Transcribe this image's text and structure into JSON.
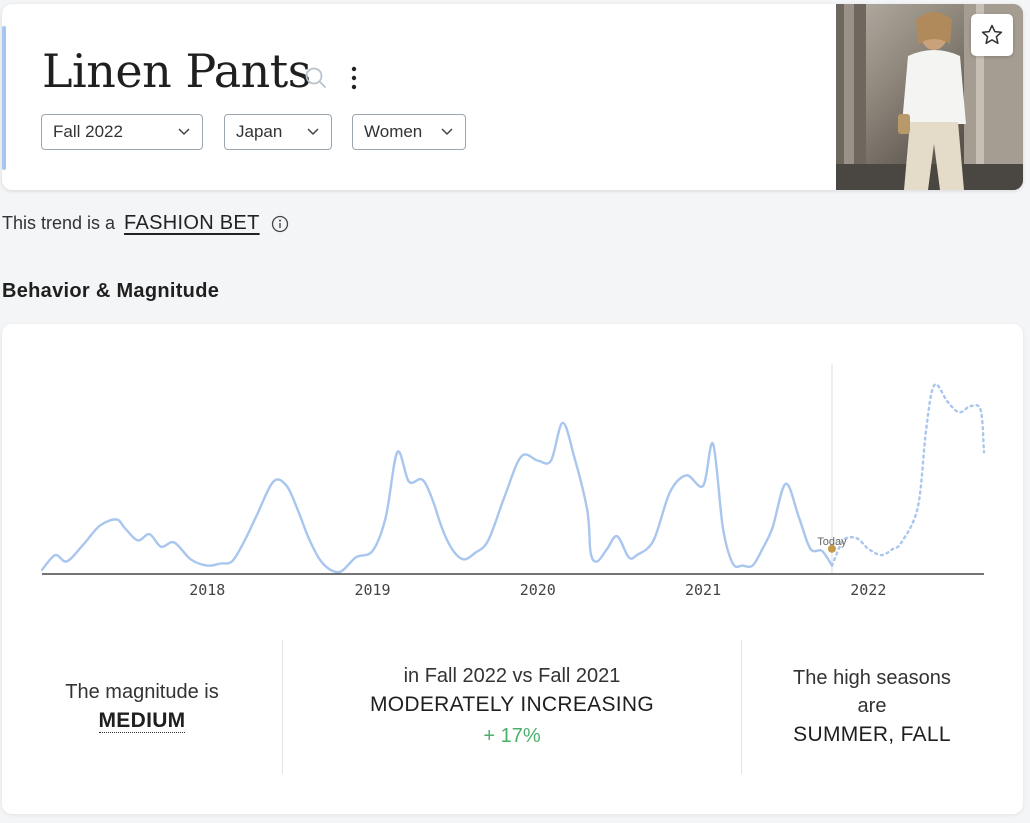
{
  "header": {
    "title": "Linen Pants",
    "filters": {
      "season": "Fall 2022",
      "country": "Japan",
      "gender": "Women"
    }
  },
  "trend": {
    "prefix": "This trend is a",
    "category": "FASHION BET"
  },
  "section": {
    "title": "Behavior & Magnitude"
  },
  "chart_data": {
    "type": "line",
    "title": "",
    "xlabel": "",
    "ylabel": "",
    "x_ticks": [
      "2018",
      "2019",
      "2020",
      "2021",
      "2022"
    ],
    "x_range": [
      2017.0,
      2022.7
    ],
    "ylim": [
      0,
      100
    ],
    "grid": false,
    "today_label": "Today",
    "today_x": 2021.78,
    "series": [
      {
        "style": "solid",
        "x": [
          2017.0,
          2017.08,
          2017.15,
          2017.25,
          2017.35,
          2017.45,
          2017.5,
          2017.58,
          2017.65,
          2017.72,
          2017.8,
          2017.9,
          2018.0,
          2018.08,
          2018.15,
          2018.22,
          2018.3,
          2018.4,
          2018.48,
          2018.55,
          2018.62,
          2018.7,
          2018.8,
          2018.9,
          2019.0,
          2019.08,
          2019.15,
          2019.22,
          2019.3,
          2019.36,
          2019.42,
          2019.48,
          2019.55,
          2019.62,
          2019.7,
          2019.8,
          2019.9,
          2020.0,
          2020.08,
          2020.15,
          2020.22,
          2020.3,
          2020.32,
          2020.36,
          2020.42,
          2020.48,
          2020.55,
          2020.6,
          2020.7,
          2020.8,
          2020.9,
          2021.0,
          2021.06,
          2021.12,
          2021.18,
          2021.24,
          2021.3,
          2021.36,
          2021.42,
          2021.5,
          2021.58,
          2021.65,
          2021.72,
          2021.78
        ],
        "y": [
          2,
          9,
          6,
          14,
          23,
          26,
          22,
          16,
          19,
          13,
          15,
          7,
          4,
          5,
          6,
          15,
          28,
          44,
          42,
          30,
          16,
          5,
          1,
          8,
          11,
          27,
          58,
          44,
          45,
          36,
          22,
          12,
          7,
          10,
          16,
          37,
          56,
          54,
          54,
          72,
          56,
          30,
          10,
          6,
          12,
          18,
          8,
          9,
          16,
          39,
          47,
          42,
          62,
          22,
          5,
          4,
          4,
          12,
          22,
          43,
          27,
          12,
          11,
          4
        ]
      },
      {
        "style": "dashed",
        "x": [
          2021.78,
          2021.85,
          2021.93,
          2022.0,
          2022.08,
          2022.15,
          2022.2,
          2022.3,
          2022.35,
          2022.4,
          2022.48,
          2022.55,
          2022.62,
          2022.68,
          2022.7
        ],
        "y": [
          4,
          16,
          17,
          12,
          9,
          12,
          15,
          32,
          69,
          90,
          82,
          77,
          80,
          78,
          58
        ]
      }
    ]
  },
  "stats": {
    "magnitude_prefix": "The magnitude is",
    "magnitude_value": "MEDIUM",
    "comparison_label": "in Fall 2022 vs Fall 2021",
    "comparison_value": "MODERATELY INCREASING",
    "comparison_change": "+ 17%",
    "seasons_line1": "The high seasons",
    "seasons_line2": "are",
    "seasons_value": "SUMMER, FALL"
  },
  "colors": {
    "accent": "#a9c6ee",
    "line": "#a9c6ee",
    "today_dot": "#c29a4a",
    "increase": "#4caf6a"
  },
  "icons": {
    "search": "search-icon",
    "more": "vertical-dots-icon",
    "chevron": "chevron-down-icon",
    "star": "star-icon",
    "info": "info-icon"
  }
}
